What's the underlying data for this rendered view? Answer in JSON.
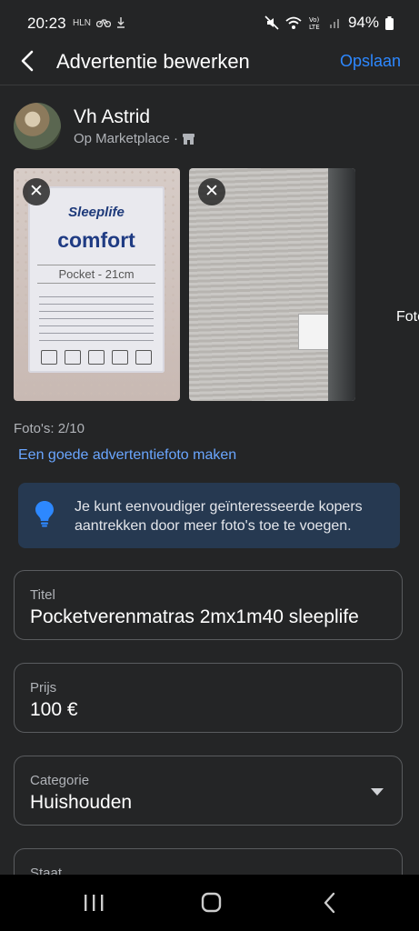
{
  "status_bar": {
    "time": "20:23",
    "left_icons": [
      "HLN",
      "bike-icon",
      "download-icon"
    ],
    "battery": "94%"
  },
  "header": {
    "title": "Advertentie bewerken",
    "save_label": "Opslaan"
  },
  "seller": {
    "name": "Vh Astrid",
    "location": "Op Marketplace ·"
  },
  "photos": {
    "label_brand": "Sleeplife",
    "label_product": "comfort",
    "label_size": "Pocket - 21cm",
    "peek_text": "Foto",
    "count": "Foto's: 2/10",
    "tip_link": "Een goede advertentiefoto maken",
    "remove_label": "✕"
  },
  "notice": {
    "text": "Je kunt eenvoudiger geïnteresseerde kopers aantrekken door meer foto's toe te voegen."
  },
  "fields": {
    "title_label": "Titel",
    "title_value": "Pocketverenmatras 2mx1m40 sleeplife",
    "price_label": "Prijs",
    "price_value": "100 €",
    "category_label": "Categorie",
    "category_value": "Huishouden",
    "condition_label": "Staat"
  },
  "colors": {
    "background": "#242526",
    "accent": "#2d88ff",
    "link": "#6aa6ff",
    "notice_bg": "#263951"
  }
}
